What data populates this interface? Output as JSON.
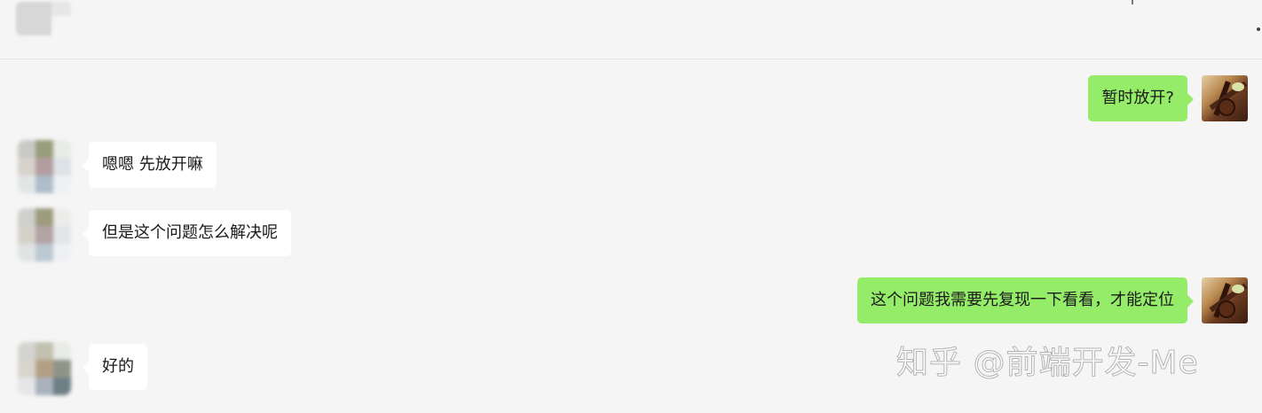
{
  "messages": [
    {
      "direction": "out",
      "text": "暂时放开?"
    },
    {
      "direction": "in",
      "text": "嗯嗯  先放开嘛"
    },
    {
      "direction": "in",
      "text": "但是这个问题怎么解决呢"
    },
    {
      "direction": "out",
      "text": "这个问题我需要先复现一下看看，才能定位"
    },
    {
      "direction": "in",
      "text": "好的"
    }
  ],
  "watermark": "知乎 @前端开发-Me",
  "colors": {
    "background": "#f5f5f5",
    "incoming_bubble": "#ffffff",
    "outgoing_bubble": "#95ec69",
    "text": "#1a1a1a"
  },
  "icons": {
    "more": "more-dots-icon"
  }
}
